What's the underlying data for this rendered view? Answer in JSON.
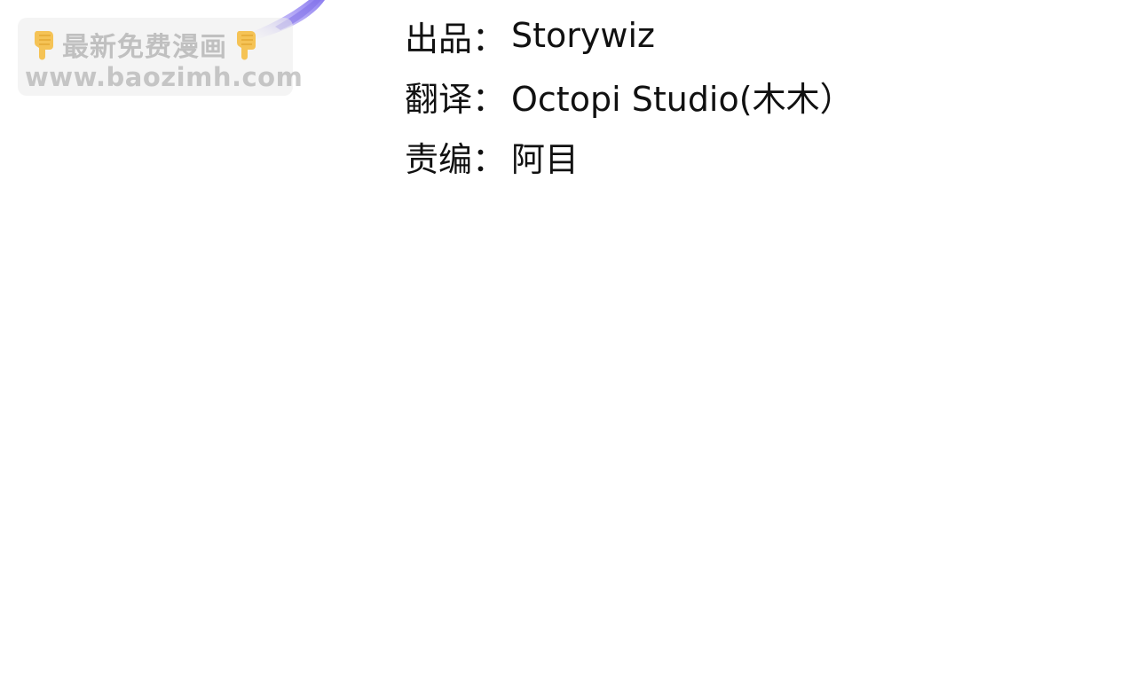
{
  "watermark": {
    "title": "最新免费漫画",
    "url": "www.baozimh.com",
    "icon_left": "pointing-down-hand-icon",
    "icon_right": "pointing-down-hand-icon",
    "hand_color": "#F5B62E"
  },
  "credits": {
    "rows": [
      {
        "label": "出品：",
        "value": "Storywiz"
      },
      {
        "label": "翻译：",
        "value": "Octopi Studio(木木）"
      },
      {
        "label": "责编：",
        "value": "阿目"
      }
    ]
  },
  "colors": {
    "background": "#FFFFFF",
    "text": "#111111",
    "brush": "#9B8CF0"
  }
}
